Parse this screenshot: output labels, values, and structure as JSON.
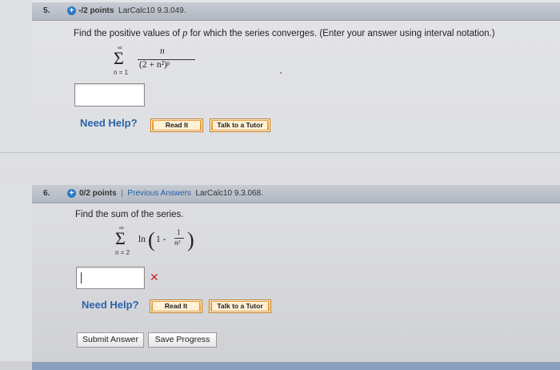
{
  "q5": {
    "number": "5.",
    "points": "-/2 points",
    "ref": "LarCalc10 9.3.049.",
    "prompt_a": "Find the positive values of ",
    "prompt_var": "p",
    "prompt_b": " for which the series converges. (Enter your answer using interval notation.)",
    "sum_upper": "∞",
    "sum_lower": "n = 1",
    "numerator": "n",
    "denominator": "(2 + n²)ᵖ",
    "answer_value": "",
    "need_help": "Need Help?",
    "read_it": "Read It",
    "talk_tutor": "Talk to a Tutor"
  },
  "q6": {
    "number": "6.",
    "points": "0/2 points",
    "separator": "|",
    "previous_answers": "Previous Answers",
    "ref": "LarCalc10 9.3.068.",
    "prompt": "Find the sum of the series.",
    "sum_upper": "∞",
    "sum_lower": "n = 2",
    "ln": "ln",
    "one_minus": "1 -",
    "frac_num": "1",
    "frac_den": "n²",
    "answer_value": "",
    "status": "incorrect",
    "need_help": "Need Help?",
    "read_it": "Read It",
    "talk_tutor": "Talk to a Tutor"
  },
  "actions": {
    "submit": "Submit Answer",
    "save": "Save Progress"
  },
  "colors": {
    "header_bg": "#b8bec8",
    "link_blue": "#2c63a8",
    "help_button": "#ee8f14",
    "wrong_mark": "#c62828"
  }
}
